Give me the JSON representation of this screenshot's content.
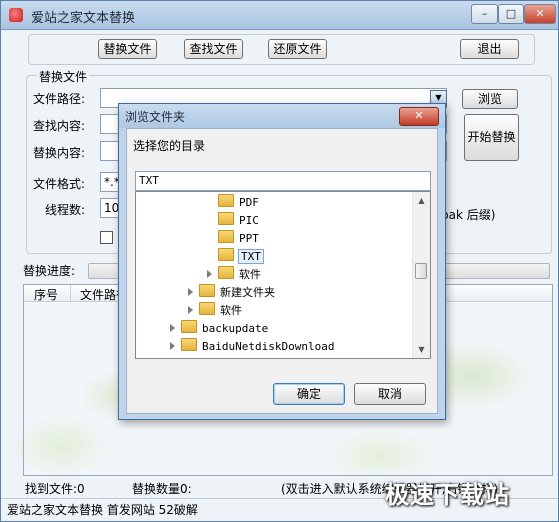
{
  "window": {
    "title": "爱站之家文本替换"
  },
  "toolbar": {
    "replace_files": "替换文件",
    "find_files": "查找文件",
    "restore_files": "还原文件",
    "exit": "退出"
  },
  "group": {
    "title": "替换文件",
    "file_path_label": "文件路径:",
    "file_path_value": "",
    "browse": "浏览",
    "find_label": "查找内容:",
    "replace_label": "替换内容:",
    "start": "开始替换",
    "format_label": "文件格式:",
    "format_value": "*.*",
    "threads_label": "线程数:",
    "threads_value": "10",
    "backup_hint": "bak 后缀)"
  },
  "progress": {
    "label": "替换进度:",
    "fraction": 0
  },
  "table": {
    "columns": [
      "序号",
      "文件路径"
    ]
  },
  "status": {
    "found": "找到文件:0",
    "replaced": "替换数量0:",
    "hint": "(双击进入默认系统编辑器打开,右键选择)",
    "footer": "爱站之家文本替换 首发网站 52破解"
  },
  "watermark": "极速下载站",
  "dialog": {
    "title": "浏览文件夹",
    "prompt": "选择您的目录",
    "path_value": "TXT",
    "tree": [
      {
        "label": "PDF",
        "level": 3,
        "expander": false,
        "selected": false
      },
      {
        "label": "PIC",
        "level": 3,
        "expander": false,
        "selected": false
      },
      {
        "label": "PPT",
        "level": 3,
        "expander": false,
        "selected": false
      },
      {
        "label": "TXT",
        "level": 3,
        "expander": false,
        "selected": true
      },
      {
        "label": "软件",
        "level": 3,
        "expander": true,
        "selected": false
      },
      {
        "label": "新建文件夹",
        "level": 2,
        "expander": true,
        "selected": false
      },
      {
        "label": "软件",
        "level": 2,
        "expander": true,
        "selected": false
      },
      {
        "label": "backupdate",
        "level": 1,
        "expander": true,
        "selected": false
      },
      {
        "label": "BaiduNetdiskDownload",
        "level": 1,
        "expander": true,
        "selected": false
      }
    ],
    "ok": "确定",
    "cancel": "取消"
  },
  "colors": {
    "progress": "#4fbf3a",
    "selection": "#e5effb",
    "folder": "#f2c94c"
  }
}
